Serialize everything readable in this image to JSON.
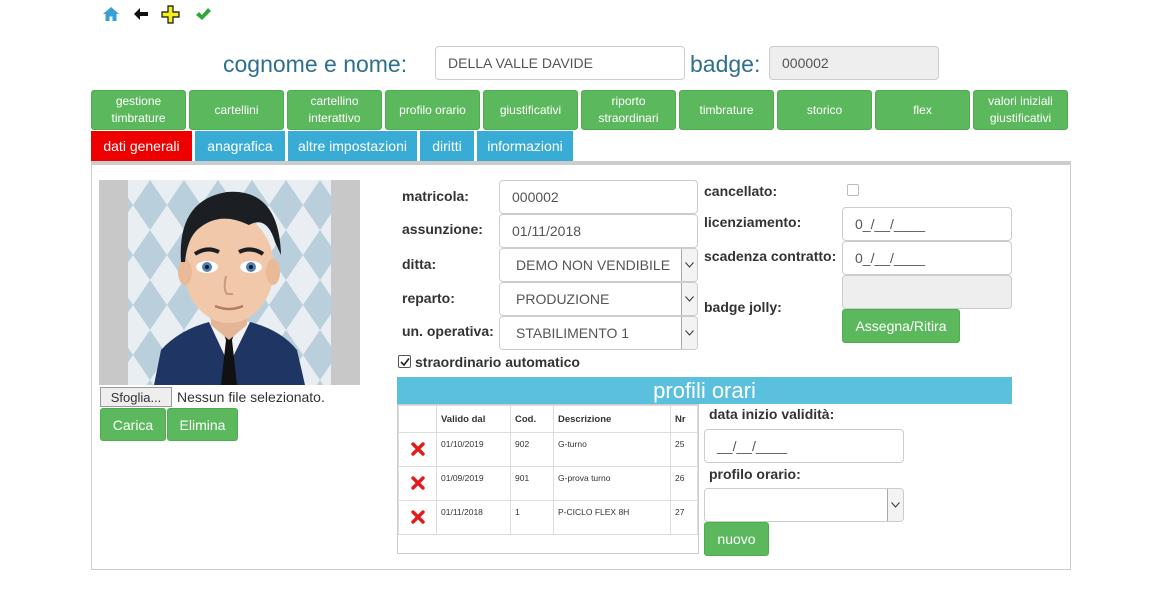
{
  "header": {
    "name_label": "cognome e nome:",
    "name_value": "DELLA VALLE DAVIDE",
    "badge_label": "badge:",
    "badge_value": "000002"
  },
  "main_tabs": [
    {
      "label1": "gestione",
      "label2": "timbrature"
    },
    {
      "label1": "cartellini",
      "label2": ""
    },
    {
      "label1": "cartellino",
      "label2": "interattivo"
    },
    {
      "label1": "profilo orario",
      "label2": ""
    },
    {
      "label1": "giustificativi",
      "label2": ""
    },
    {
      "label1": "riporto",
      "label2": "straordinari"
    },
    {
      "label1": "timbrature",
      "label2": ""
    },
    {
      "label1": "storico",
      "label2": ""
    },
    {
      "label1": "flex",
      "label2": ""
    },
    {
      "label1": "valori iniziali",
      "label2": "giustificativi"
    }
  ],
  "sub_tabs": [
    "dati generali",
    "anagrafica",
    "altre impostazioni",
    "diritti",
    "informazioni"
  ],
  "photo": {
    "browse_label": "Sfoglia...",
    "no_file": "Nessun file selezionato.",
    "upload_label": "Carica",
    "delete_label": "Elimina"
  },
  "form": {
    "matricola_label": "matricola:",
    "matricola_value": "000002",
    "assunzione_label": "assunzione:",
    "assunzione_value": "01/11/2018",
    "ditta_label": "ditta:",
    "ditta_value": "DEMO NON VENDIBILE",
    "reparto_label": "reparto:",
    "reparto_value": "PRODUZIONE",
    "unop_label": "un. operativa:",
    "unop_value": "STABILIMENTO 1",
    "straord_label": "straordinario automatico",
    "cancellato_label": "cancellato:",
    "licenz_label": "licenziamento:",
    "licenz_value": "0_/__/____",
    "scadenza_label": "scadenza contratto:",
    "scadenza_value": "0_/__/____",
    "jolly_label": "badge jolly:",
    "assegna_label": "Assegna/Ritira"
  },
  "profili": {
    "title": "profili orari",
    "columns": [
      "Valido dal",
      "Cod.",
      "Descrizione",
      "Nr"
    ],
    "rows": [
      {
        "valido": "01/10/2019",
        "cod": "902",
        "desc": "G-turno",
        "nr": "25"
      },
      {
        "valido": "01/09/2019",
        "cod": "901",
        "desc": "G-prova turno",
        "nr": "26"
      },
      {
        "valido": "01/11/2018",
        "cod": "1",
        "desc": "P-CICLO FLEX 8H",
        "nr": "27"
      }
    ],
    "data_inizio_label": "data inizio validità:",
    "data_inizio_value": "__/__/____",
    "profilo_label": "profilo orario:",
    "nuovo_label": "nuovo"
  },
  "colors": {
    "green": "#5cb85c",
    "blue": "#39acd6",
    "red": "#ee0000",
    "header_blue": "#5bc0de"
  }
}
